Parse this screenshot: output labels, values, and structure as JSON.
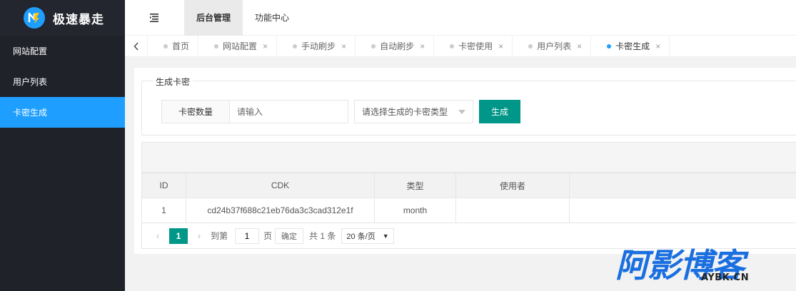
{
  "brand": {
    "name": "极速暴走",
    "accent": "#1e9fff",
    "logo_icon": "lightning-n-logo"
  },
  "sidebar": {
    "items": [
      {
        "label": "网站配置",
        "active": false
      },
      {
        "label": "用户列表",
        "active": false
      },
      {
        "label": "卡密生成",
        "active": true
      }
    ]
  },
  "header": {
    "toggle_icon": "menu-fold-icon",
    "tabs": [
      {
        "label": "后台管理",
        "active": true
      },
      {
        "label": "功能中心",
        "active": false
      }
    ]
  },
  "tabbar": {
    "prev_icon": "chevron-left-icon",
    "close_glyph": "×",
    "tabs": [
      {
        "label": "首页",
        "closable": false,
        "active": false
      },
      {
        "label": "网站配置",
        "closable": true,
        "active": false
      },
      {
        "label": "手动刷步",
        "closable": true,
        "active": false
      },
      {
        "label": "自动刷步",
        "closable": true,
        "active": false
      },
      {
        "label": "卡密使用",
        "closable": true,
        "active": false
      },
      {
        "label": "用户列表",
        "closable": true,
        "active": false
      },
      {
        "label": "卡密生成",
        "closable": true,
        "active": true
      }
    ]
  },
  "form": {
    "legend": "生成卡密",
    "count_label": "卡密数量",
    "count_placeholder": "请输入",
    "type_select_placeholder": "请选择生成的卡密类型",
    "generate_button": "生成",
    "button_color": "#009688"
  },
  "table": {
    "columns": [
      "ID",
      "CDK",
      "类型",
      "使用者",
      ""
    ],
    "rows": [
      {
        "id": "1",
        "cdk": "cd24b37f688c21eb76da3c3cad312e1f",
        "type": "month",
        "user": "",
        "extra": ""
      }
    ]
  },
  "pagination": {
    "current_page": "1",
    "goto_label": "到第",
    "goto_value": "1",
    "page_unit": "页",
    "confirm_label": "确定",
    "total_text": "共 1 条",
    "page_size": "20 条/页"
  },
  "watermark": {
    "text": "阿影博客",
    "sub": "AYBK.CN"
  }
}
